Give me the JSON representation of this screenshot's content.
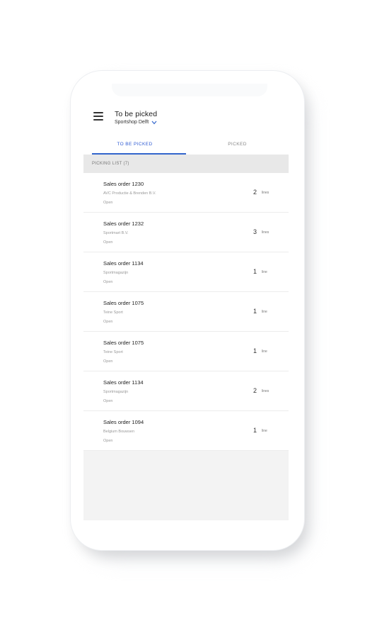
{
  "header": {
    "title": "To be picked",
    "subtitle": "Sportshop Delft"
  },
  "tabs": [
    {
      "label": "TO BE PICKED",
      "active": true
    },
    {
      "label": "PICKED",
      "active": false
    }
  ],
  "section": {
    "label": "PICKING LIST (7)"
  },
  "items": [
    {
      "title": "Sales order 1230",
      "customer": "AVC Productie & Brenden B.V.",
      "status": "Open",
      "count": "2",
      "unit": "lines"
    },
    {
      "title": "Sales order 1232",
      "customer": "Sportmart B.V.",
      "status": "Open",
      "count": "3",
      "unit": "lines"
    },
    {
      "title": "Sales order 1134",
      "customer": "Sportmagazijn",
      "status": "Open",
      "count": "1",
      "unit": "line"
    },
    {
      "title": "Sales order 1075",
      "customer": "Teine Sport",
      "status": "Open",
      "count": "1",
      "unit": "line"
    },
    {
      "title": "Sales order 1075",
      "customer": "Teine Sport",
      "status": "Open",
      "count": "1",
      "unit": "line"
    },
    {
      "title": "Sales order 1134",
      "customer": "Sportmagazijn",
      "status": "Open",
      "count": "2",
      "unit": "lines"
    },
    {
      "title": "Sales order 1094",
      "customer": "Belgium Bouwsen",
      "status": "Open",
      "count": "1",
      "unit": "line"
    }
  ],
  "icons": {
    "menu": "menu-icon",
    "chevron": "chevron-down-icon"
  },
  "colors": {
    "accent": "#3366cc",
    "background": "#f3f3f3"
  }
}
